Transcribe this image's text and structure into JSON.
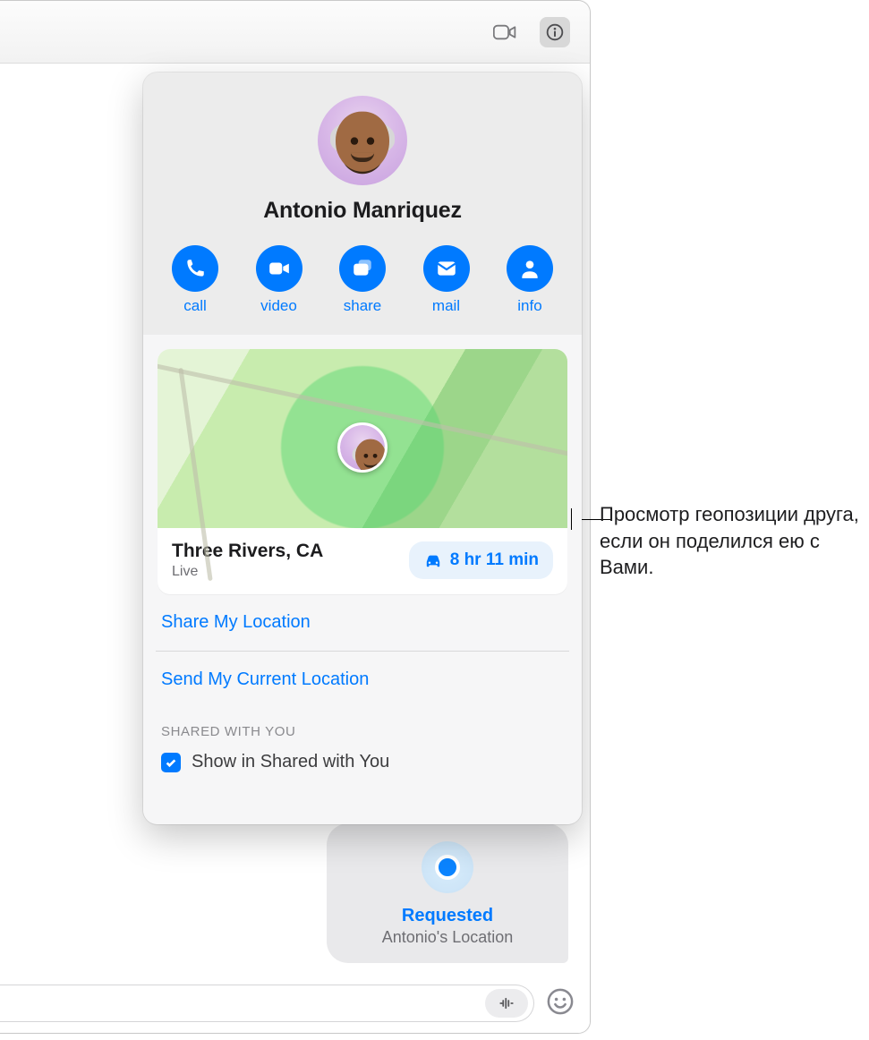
{
  "toolbar": {
    "facetime_icon": "facetime",
    "info_icon": "info"
  },
  "contact": {
    "name": "Antonio Manriquez"
  },
  "actions": {
    "call": "call",
    "video": "video",
    "share": "share",
    "mail": "mail",
    "info": "info"
  },
  "location": {
    "place": "Three Rivers, CA",
    "status": "Live",
    "eta": "8 hr 11 min"
  },
  "links": {
    "share_my_location": "Share My Location",
    "send_current_location": "Send My Current Location"
  },
  "shared_with_you": {
    "section_label": "SHARED WITH YOU",
    "toggle_label": "Show in Shared with You",
    "toggle_checked": true
  },
  "message_bubble": {
    "title": "Requested",
    "subtitle": "Antonio's Location"
  },
  "callout": {
    "text": "Просмотр геопозиции друга, если он поделился ею с Вами."
  }
}
